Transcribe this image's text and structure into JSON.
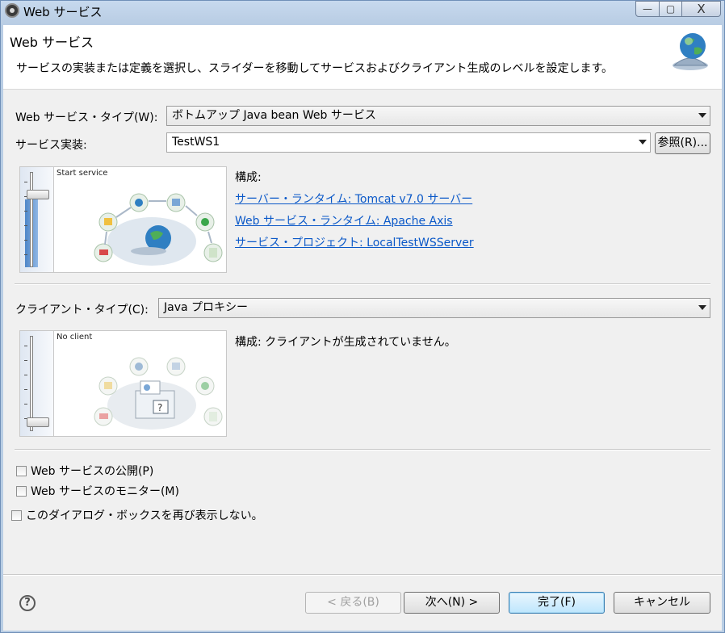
{
  "window": {
    "title": "Web サービス",
    "buttons": {
      "minimize": "—",
      "maximize": "▢",
      "close": "X"
    }
  },
  "header": {
    "title": "Web サービス",
    "description": "サービスの実装または定義を選択し、スライダーを移動してサービスおよびクライアント生成のレベルを設定します。"
  },
  "service": {
    "type_label": "Web サービス・タイプ(W):",
    "type_value": "ボトムアップ Java bean Web サービス",
    "impl_label": "サービス実装:",
    "impl_value": "TestWS1",
    "browse_button": "参照(R)...",
    "slider_caption": "Start service",
    "config_heading": "構成:",
    "links": [
      "サーバー・ランタイム: Tomcat v7.0 サーバー",
      "Web サービス・ランタイム: Apache Axis",
      "サービス・プロジェクト: LocalTestWSServer"
    ]
  },
  "client": {
    "type_label": "クライアント・タイプ(C):",
    "type_value": "Java プロキシー",
    "slider_caption": "No client",
    "config_text": "構成: クライアントが生成されていません。"
  },
  "checkboxes": {
    "publish": "Web サービスの公開(P)",
    "monitor": "Web サービスのモニター(M)",
    "dont_show": "このダイアログ・ボックスを再び表示しない。"
  },
  "footer": {
    "back": "< 戻る(B)",
    "next": "次へ(N) >",
    "finish": "完了(F)",
    "cancel": "キャンセル"
  },
  "icons": {
    "app": "eclipse-icon",
    "header": "web-service-globe-icon",
    "help": "help-icon"
  }
}
